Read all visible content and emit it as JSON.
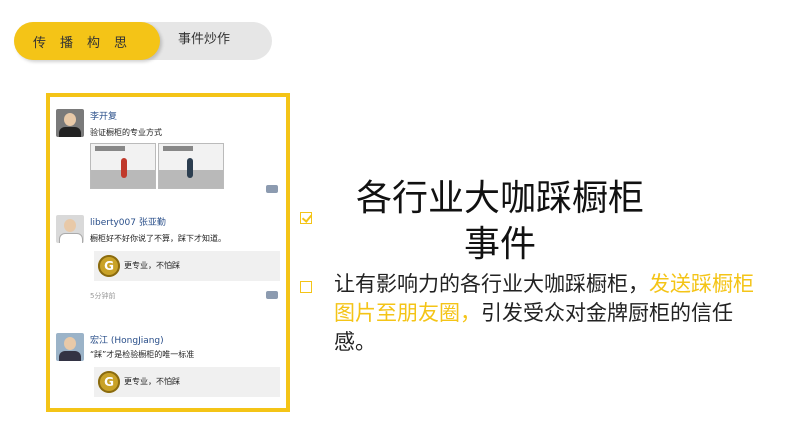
{
  "tabs": {
    "active_label": "传播构思",
    "inactive_label": "事件炒作"
  },
  "feed": [
    {
      "name": "李开复",
      "text": "验证橱柜的专业方式",
      "has_photos": true
    },
    {
      "name": "liberty007 张亚勤",
      "text": "橱柜好不好你说了不算，踩下才知道。",
      "share_text": "更专业，不怕踩",
      "time": "5分钟前"
    },
    {
      "name": "宏江 (HongJiang)",
      "text": "“踩”才是检验橱柜的唯一标准",
      "share_text": "更专业，不怕踩"
    }
  ],
  "headline": {
    "title": "各行业大咖踩橱柜事件",
    "body_prefix": "让有影响力的各行业大咖踩橱柜，",
    "body_highlight": "发送踩橱柜图片至朋友圈，",
    "body_suffix": "引发受众对金牌厨柜的信任感。"
  },
  "colors": {
    "accent": "#f4c417",
    "tab_bg": "#e6e6e6",
    "name_blue": "#2a4f8a"
  },
  "icons": {
    "title_marker": "checkbox-checked-icon",
    "bullet_marker": "checkbox-empty-icon",
    "share_logo": "gold-g-logo-icon",
    "comment": "comment-icon"
  },
  "share_logo_letter": "G"
}
